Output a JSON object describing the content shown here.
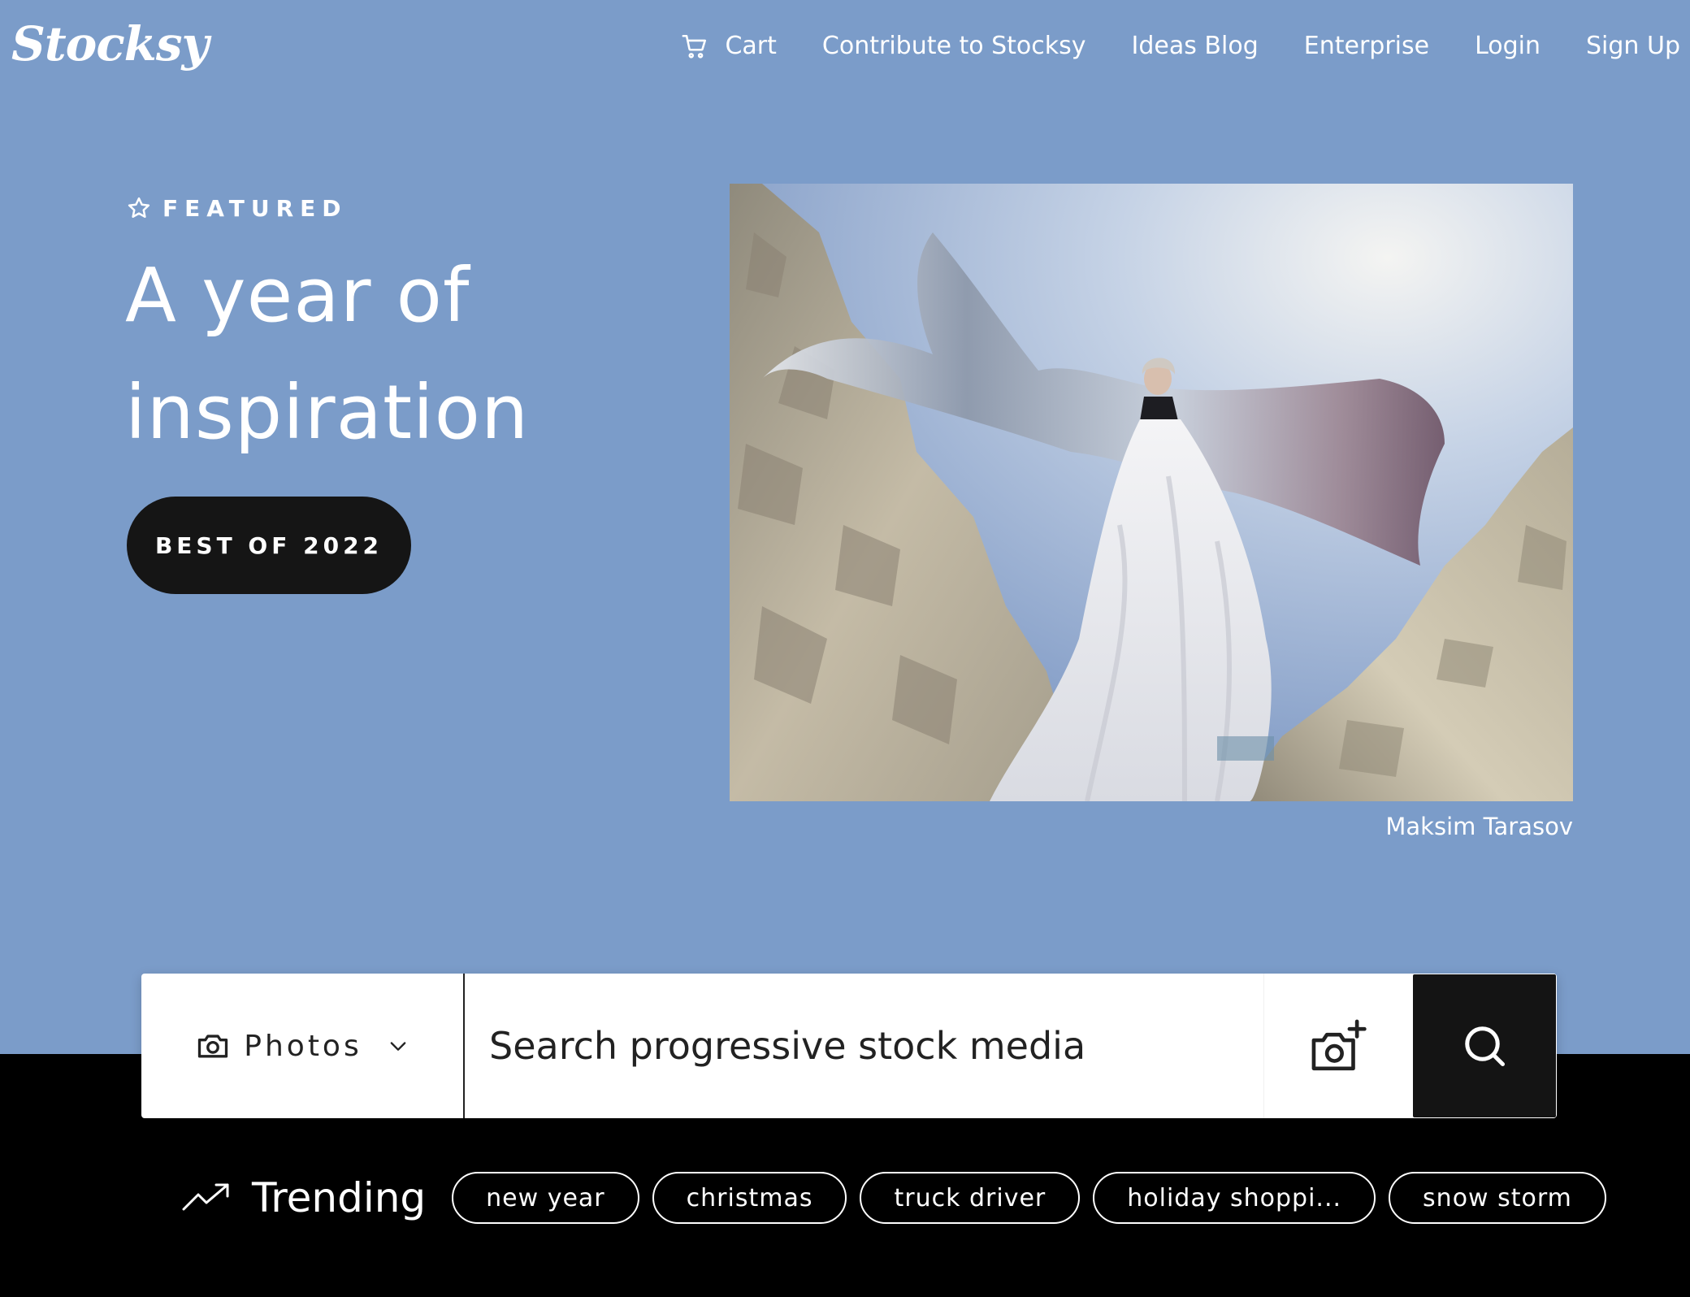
{
  "header": {
    "logo_text": "Stocksy",
    "nav": {
      "cart": "Cart",
      "contribute": "Contribute to Stocksy",
      "blog": "Ideas Blog",
      "enterprise": "Enterprise",
      "login": "Login",
      "signup": "Sign Up"
    }
  },
  "featured": {
    "eyebrow": "FEATURED",
    "headline_line1": "A year of",
    "headline_line2": "inspiration",
    "cta_label": "BEST OF 2022",
    "photo_credit": "Maksim Tarasov"
  },
  "search": {
    "media_type": "Photos",
    "placeholder": "Search progressive stock media",
    "value": ""
  },
  "trending": {
    "label": "Trending",
    "terms": [
      "new year",
      "christmas",
      "truck driver",
      "holiday shoppi...",
      "snow storm"
    ]
  },
  "colors": {
    "hero_background": "#7b9cc9",
    "dark_background": "#000000",
    "button_dark": "#151515",
    "text_light": "#ffffff"
  },
  "icons": [
    "cart-icon",
    "star-icon",
    "camera-icon",
    "chevron-down-icon",
    "camera-plus-icon",
    "search-icon",
    "trending-up-icon"
  ]
}
